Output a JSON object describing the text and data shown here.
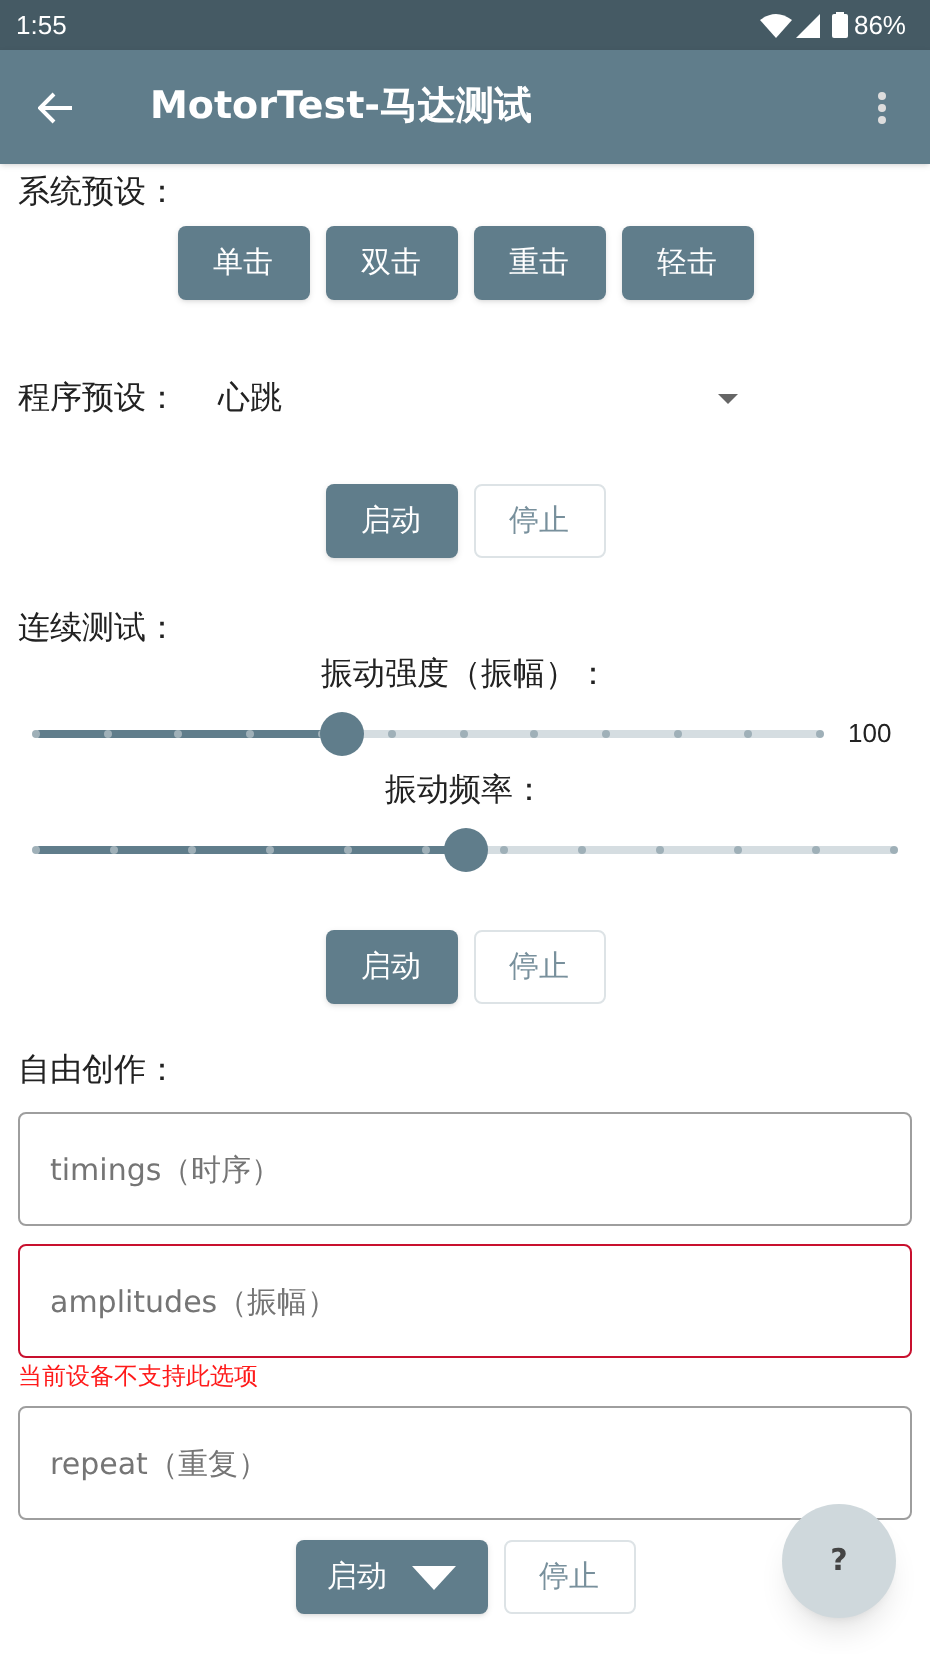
{
  "status_bar": {
    "time": "1:55",
    "battery": "86%"
  },
  "app_bar": {
    "title": "MotorTest-马达测试"
  },
  "system_presets": {
    "label": "系统预设：",
    "buttons": [
      "单击",
      "双击",
      "重击",
      "轻击"
    ]
  },
  "program_preset": {
    "label": "程序预设：",
    "value": "心跳",
    "actions": [
      {
        "label": "启动",
        "primary": true
      },
      {
        "label": "停止",
        "primary": false
      }
    ]
  },
  "continuous": {
    "label": "连续测试：",
    "sliders": [
      {
        "label": "振动强度（振幅）：",
        "level": 0.39,
        "reading": "100"
      },
      {
        "label": "振动频率：",
        "level": 0.5
      }
    ],
    "actions": [
      {
        "label": "启动",
        "primary": true
      },
      {
        "label": "停止",
        "primary": false
      }
    ]
  },
  "free_create": {
    "label": "自由创作：",
    "fields": [
      {
        "placeholder": "timings（时序）",
        "error": false
      },
      {
        "placeholder": "amplitudes（振幅）",
        "error": true,
        "error_text": "当前设备不支持此选项"
      },
      {
        "placeholder": "repeat（重复）",
        "error": false
      }
    ],
    "actions": [
      {
        "label": "启动",
        "primary": true,
        "dropdown": true
      },
      {
        "label": "停止",
        "primary": false
      }
    ]
  },
  "fab": {
    "label": "?"
  }
}
